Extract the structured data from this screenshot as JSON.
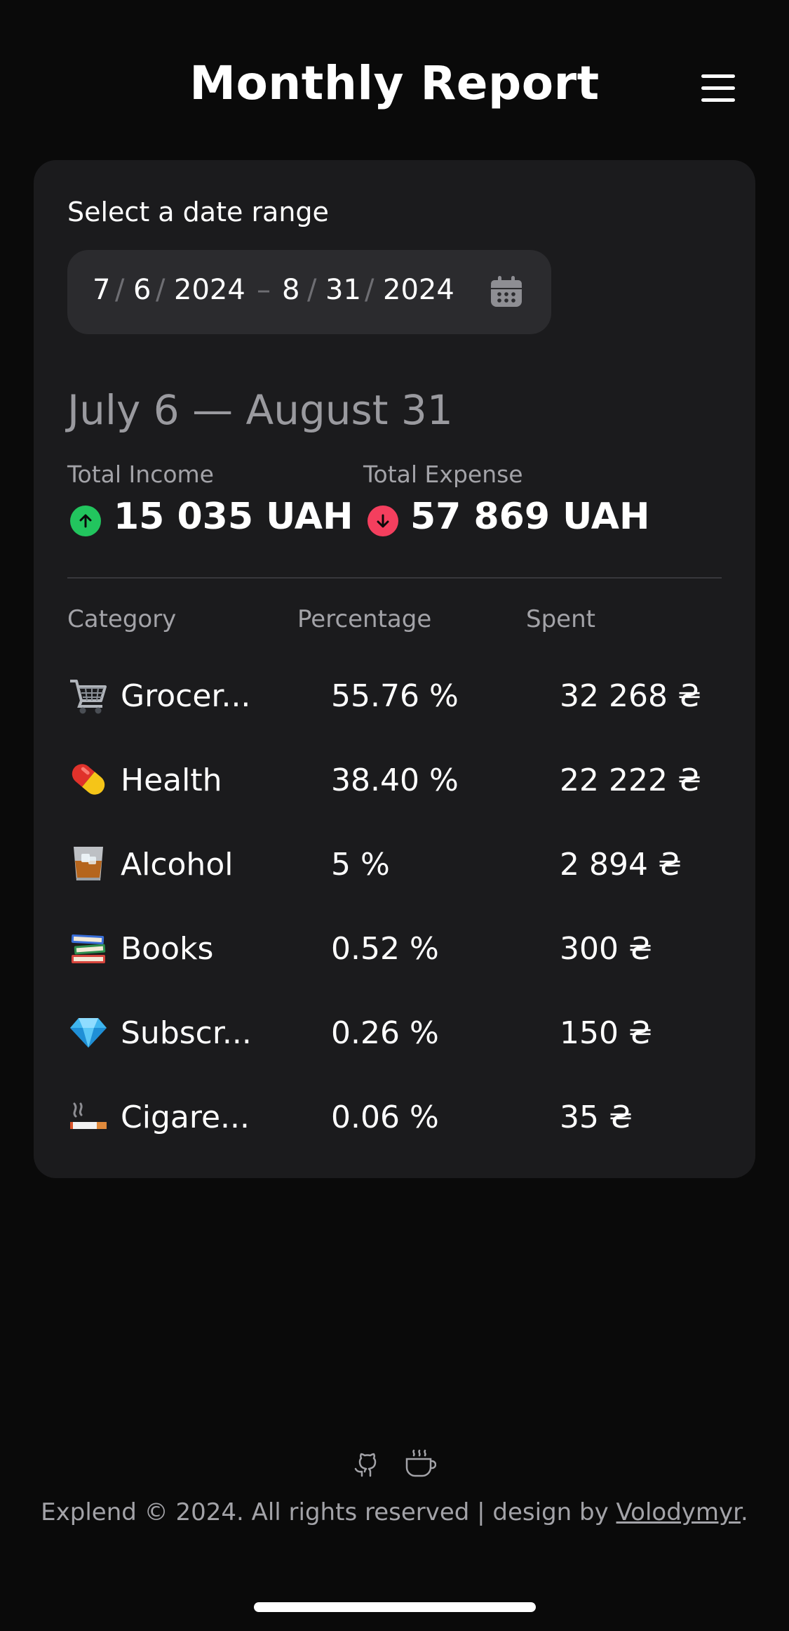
{
  "header": {
    "title": "Monthly Report",
    "menu_icon": "hamburger-menu-icon"
  },
  "date_range": {
    "label": "Select a date range",
    "start": {
      "month": "7",
      "day": "6",
      "year": "2024"
    },
    "end": {
      "month": "8",
      "day": "31",
      "year": "2024"
    },
    "separator": "/",
    "dash": "–",
    "calendar_icon": "calendar-icon"
  },
  "summary": {
    "range_title": "July 6 — August 31",
    "income": {
      "label": "Total Income",
      "value": "15 035 UAH",
      "color": "#22c55e",
      "icon": "arrow-up-icon"
    },
    "expense": {
      "label": "Total Expense",
      "value": "57 869 UAH",
      "color": "#f43f5e",
      "icon": "arrow-down-icon"
    }
  },
  "table": {
    "headers": [
      "Category",
      "Percentage",
      "Spent"
    ],
    "rows": [
      {
        "icon": "shopping-cart-icon",
        "name": "Grocer...",
        "percentage": "55.76 %",
        "spent": "32 268 ₴"
      },
      {
        "icon": "pill-icon",
        "name": "Health",
        "percentage": "38.40 %",
        "spent": "22 222 ₴"
      },
      {
        "icon": "whiskey-glass-icon",
        "name": "Alcohol",
        "percentage": "5 %",
        "spent": "2 894 ₴"
      },
      {
        "icon": "books-icon",
        "name": "Books",
        "percentage": "0.52 %",
        "spent": "300 ₴"
      },
      {
        "icon": "gem-icon",
        "name": "Subscr...",
        "percentage": "0.26 %",
        "spent": "150 ₴"
      },
      {
        "icon": "cigarette-icon",
        "name": "Cigare...",
        "percentage": "0.06 %",
        "spent": "35 ₴"
      }
    ]
  },
  "footer": {
    "icons": [
      "github-icon",
      "coffee-cup-icon"
    ],
    "text_before": "Explend © 2024. All rights reserved | design by ",
    "author": "Volodymyr",
    "text_after": "."
  },
  "colors": {
    "background": "#0a0a0a",
    "card": "#1b1b1d",
    "input": "#2b2b2e"
  }
}
